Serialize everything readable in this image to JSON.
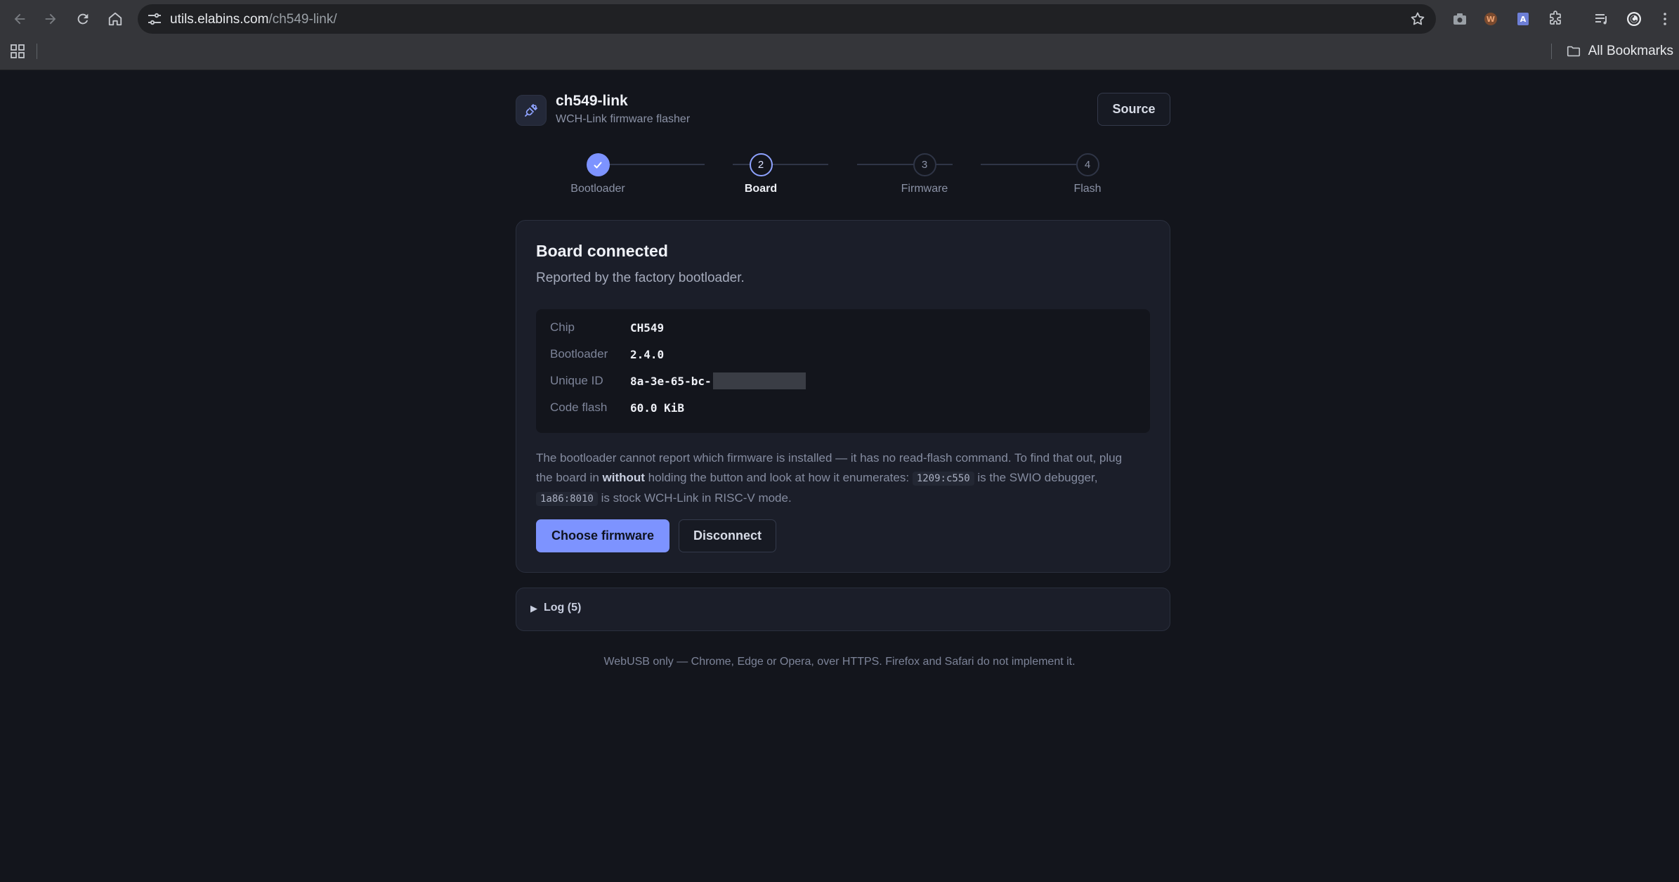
{
  "browser": {
    "url_host": "utils.elabins.com",
    "url_path": "/ch549-link/",
    "bookmarks_label": "All Bookmarks"
  },
  "app": {
    "title": "ch549-link",
    "subtitle": "WCH-Link firmware flasher",
    "source_label": "Source"
  },
  "stepper": {
    "steps": [
      {
        "number": "1",
        "label": "Bootloader",
        "state": "done"
      },
      {
        "number": "2",
        "label": "Board",
        "state": "current"
      },
      {
        "number": "3",
        "label": "Firmware",
        "state": "todo"
      },
      {
        "number": "4",
        "label": "Flash",
        "state": "todo"
      }
    ]
  },
  "card": {
    "title": "Board connected",
    "subtitle": "Reported by the factory bootloader.",
    "info": [
      {
        "key": "Chip",
        "value": "CH549"
      },
      {
        "key": "Bootloader",
        "value": "2.4.0"
      },
      {
        "key": "Unique ID",
        "value": "8a-3e-65-bc-"
      },
      {
        "key": "Code flash",
        "value": "60.0 KiB"
      }
    ],
    "note": {
      "part1": "The bootloader cannot report which firmware is installed — it has no read-flash command. To find that out, plug the board in ",
      "emphasis": "without",
      "part2": " holding the button and look at how it enumerates: ",
      "code1": "1209:c550",
      "part3": " is the SWIO debugger, ",
      "code2": "1a86:8010",
      "part4": " is stock WCH-Link in RISC-V mode."
    },
    "primary_button": "Choose firmware",
    "secondary_button": "Disconnect"
  },
  "log": {
    "label": "Log (5)"
  },
  "footer": "WebUSB only — Chrome, Edge or Opera, over HTTPS. Firefox and Safari do not implement it.",
  "colors": {
    "accent": "#7d93ff",
    "background": "#13151c",
    "card": "#1b1e29"
  }
}
